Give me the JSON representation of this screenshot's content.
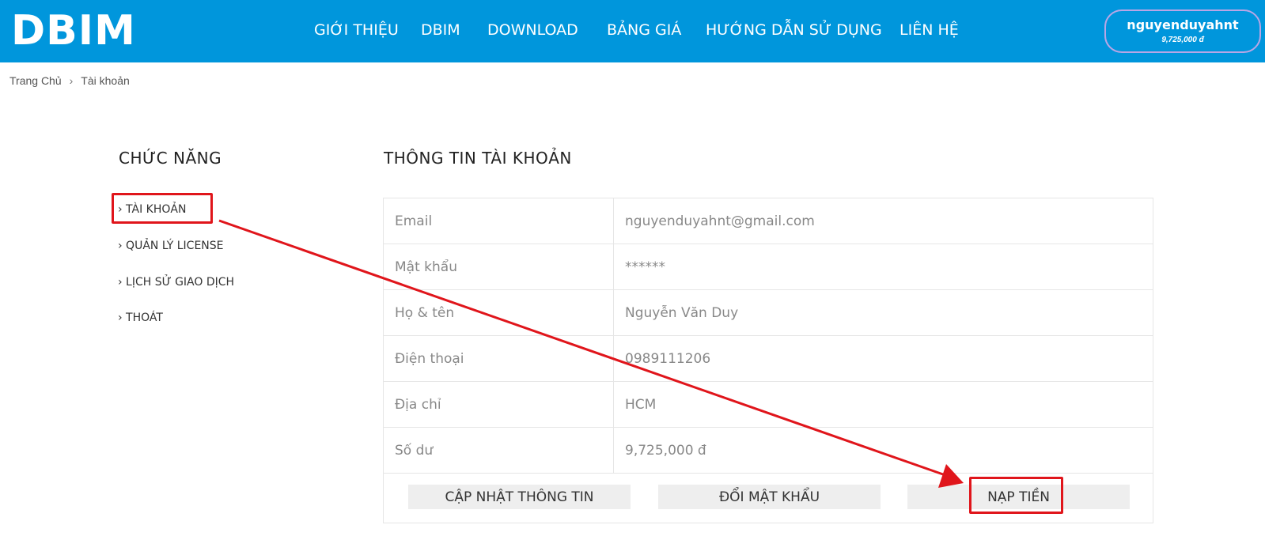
{
  "header": {
    "logo": "DBIM",
    "nav": [
      "GIỚI THIỆU",
      "DBIM",
      "DOWNLOAD",
      "BẢNG GIÁ",
      "HƯỚNG DẪN SỬ DỤNG",
      "LIÊN HỆ"
    ],
    "account": {
      "username": "nguyenduyahnt",
      "balance": "9,725,000 đ"
    }
  },
  "breadcrumb": {
    "home": "Trang Chủ",
    "separator": "›",
    "current": "Tài khoản"
  },
  "sidebar": {
    "title": "CHỨC NĂNG",
    "items": [
      "› TÀI KHOẢN",
      "› QUẢN LÝ LICENSE",
      "› LỊCH SỬ GIAO DỊCH",
      "› THOÁT"
    ]
  },
  "main": {
    "title": "THÔNG TIN TÀI KHOẢN",
    "rows": [
      {
        "label": "Email",
        "value": "nguyenduyahnt@gmail.com"
      },
      {
        "label": "Mật khẩu",
        "value": "******"
      },
      {
        "label": "Họ & tên",
        "value": "Nguyễn Văn Duy"
      },
      {
        "label": "Điện thoại",
        "value": "0989111206"
      },
      {
        "label": "Địa chỉ",
        "value": "HCM"
      },
      {
        "label": "Số dư",
        "value": "9,725,000 đ"
      }
    ],
    "buttons": {
      "update": "CẬP NHẬT THÔNG TIN",
      "change_password": "ĐỔI MẬT KHẨU",
      "deposit": "NẠP TIỀN"
    }
  },
  "colors": {
    "header_bg": "#0096dc",
    "annotation": "#e0151b",
    "button_bg": "#eeeeee"
  }
}
